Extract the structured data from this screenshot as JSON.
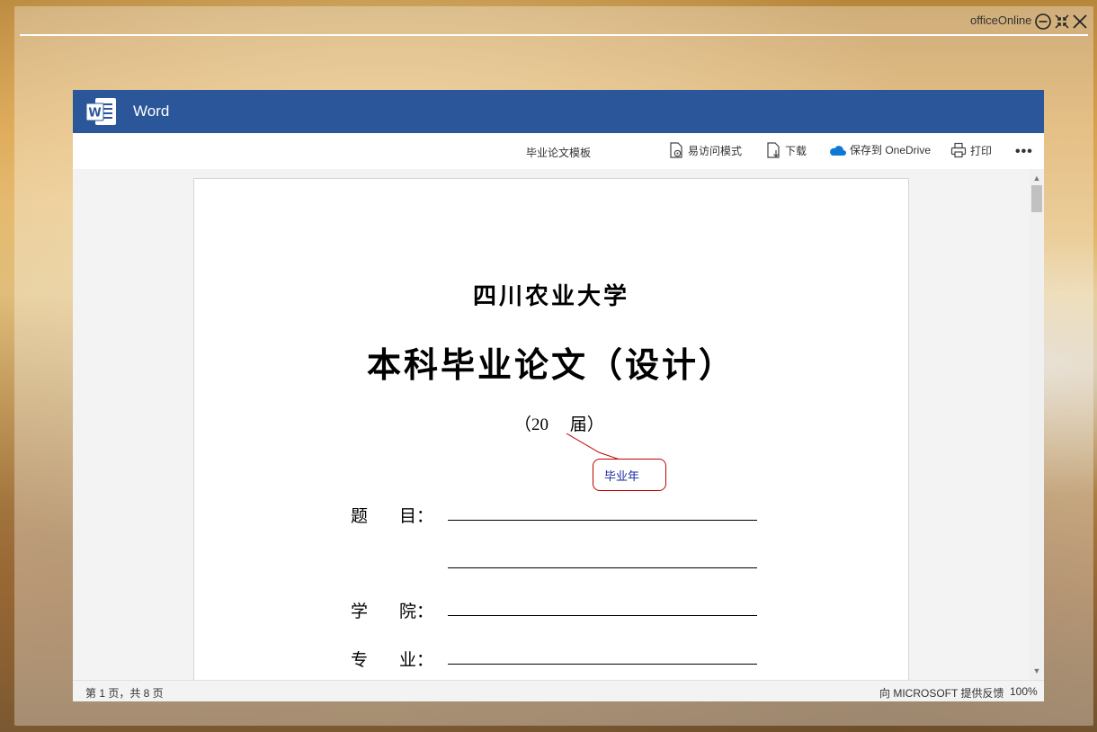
{
  "window": {
    "app_title": "officeOnline",
    "icons": [
      "minimize-circle-icon",
      "shrink-icon",
      "close-icon"
    ]
  },
  "word": {
    "app_name": "Word",
    "brand_color": "#2b579a",
    "toolbar": {
      "doc_name": "毕业论文模板",
      "accessibility_label": "易访问模式",
      "download_label": "下载",
      "save_onedrive_label": "保存到 OneDrive",
      "print_label": "打印",
      "more_label": "•••"
    },
    "document": {
      "university": "四川农业大学",
      "title": "本科毕业论文（设计）",
      "year_line": "（20     届）",
      "comment": "毕业年",
      "fields": [
        {
          "char1": "题",
          "char2": "目："
        },
        {
          "char1": "学",
          "char2": "院："
        },
        {
          "char1": "专",
          "char2": "业："
        }
      ]
    },
    "status": {
      "page_count": "第 1 页，共 8 页",
      "feedback": "向 MICROSOFT 提供反馈",
      "zoom": "100%"
    }
  }
}
